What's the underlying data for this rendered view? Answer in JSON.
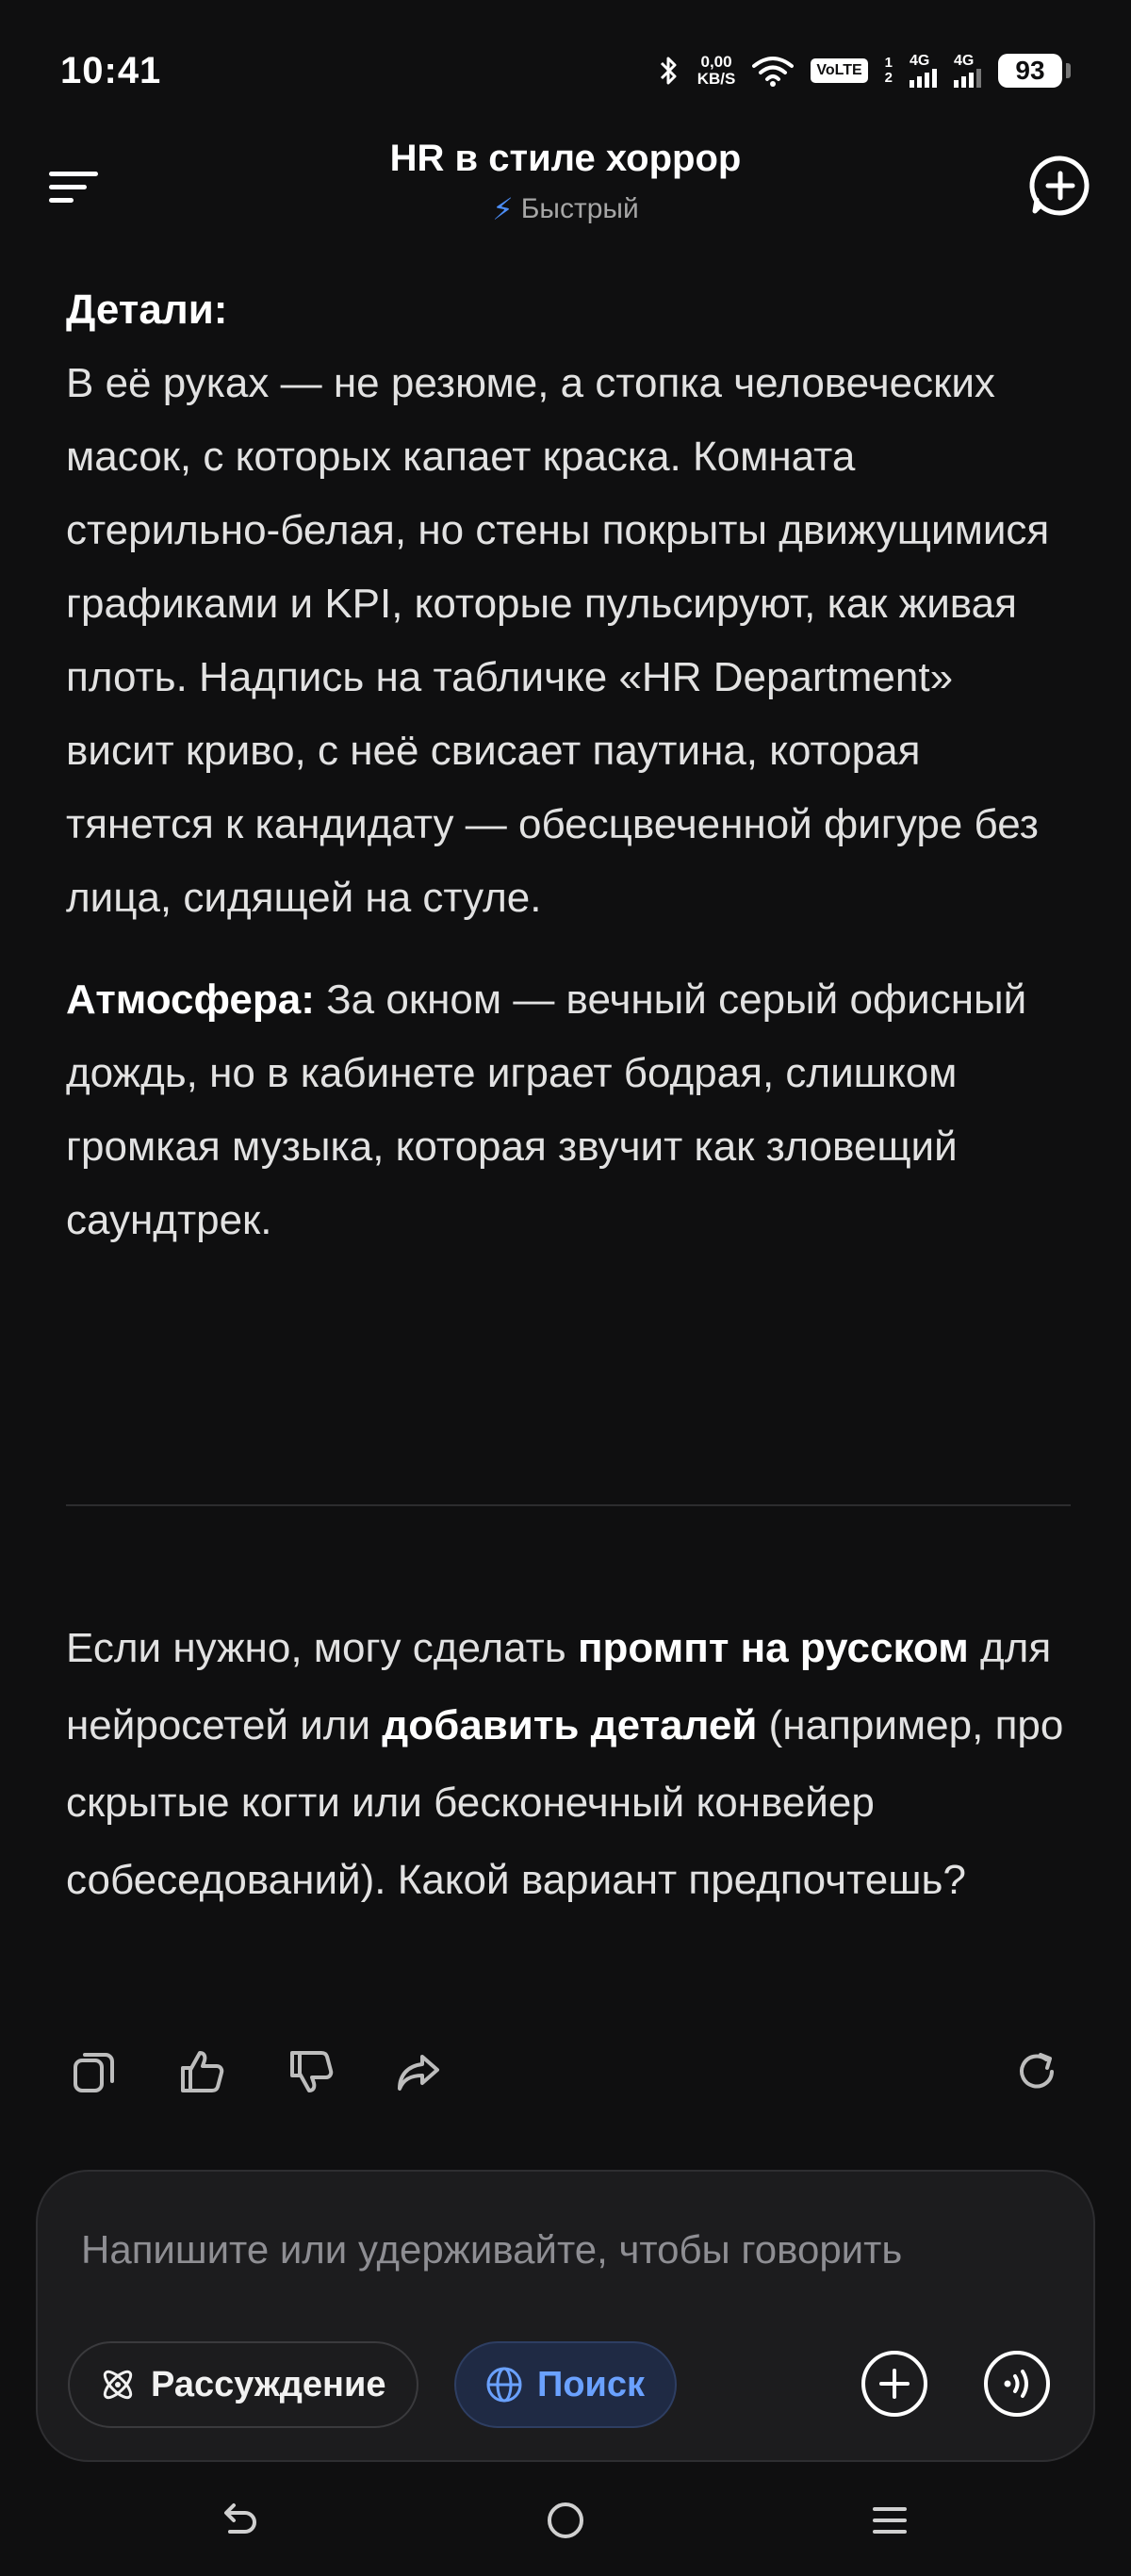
{
  "status_bar": {
    "time": "10:41",
    "net_speed_value": "0,00",
    "net_speed_unit": "KB/S",
    "volte": "VoLTE",
    "sim1_index": "1",
    "sim2_index": "2",
    "sim1_network": "4G",
    "sim2_network": "4G",
    "battery": "93"
  },
  "header": {
    "title": "HR в стиле хоррор",
    "mode": "Быстрый"
  },
  "message": {
    "details_label": "Детали:",
    "details_text": "В её руках — не резюме, а стопка человеческих масок, с которых капает краска. Комната стерильно-белая, но стены покрыты движущимися графиками и KPI, которые пульсируют, как живая плоть. Надпись на табличке «HR Department» висит криво, с неё свисает паутина, которая тянется к кандидату — обесцвеченной фигуре без лица, сидящей на стуле.",
    "atmosphere_label": "Атмосфера:",
    "atmosphere_text": " За окном — вечный серый офисный дождь, но в кабинете играет бодрая, слишком громкая музыка, которая звучит как зловещий саундтрек.",
    "followup_1": "Если нужно, могу сделать ",
    "followup_bold_1": "промпт на русском",
    "followup_2": " для нейросетей или ",
    "followup_bold_2": "добавить деталей",
    "followup_3": " (например, про скрытые когти или бесконечный конвейер собеседований). Какой вариант предпочтешь?"
  },
  "composer": {
    "placeholder": "Напишите или удерживайте, чтобы говорить",
    "reasoning_label": "Рассуждение",
    "search_label": "Поиск"
  },
  "colors": {
    "background": "#0f0f10",
    "accent_blue": "#4c8df6",
    "search_chip_bg": "#1f2a44"
  }
}
